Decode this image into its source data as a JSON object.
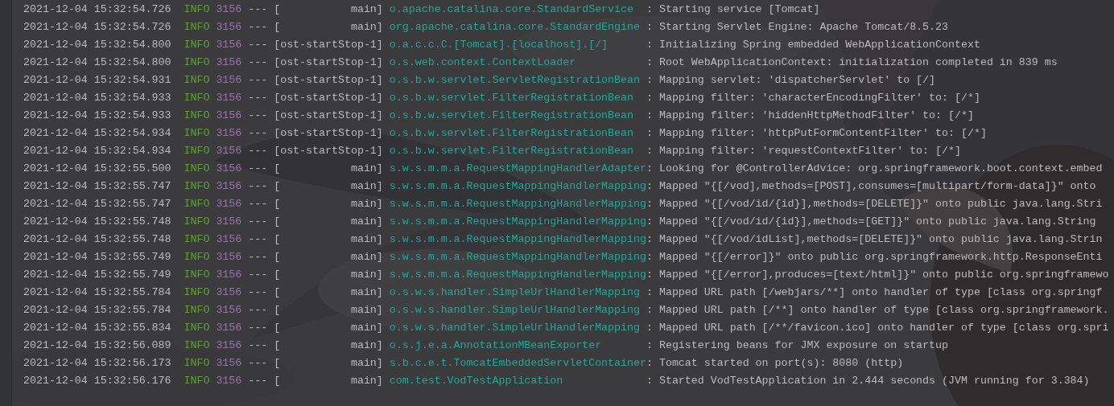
{
  "console": {
    "rows": [
      {
        "timestamp": "2021-12-04 15:32:54.726",
        "level": "INFO",
        "pid": "3156",
        "separator": "---",
        "thread": "[           main]",
        "logger": "o.apache.catalina.core.StandardService",
        "message": ": Starting service [Tomcat]"
      },
      {
        "timestamp": "2021-12-04 15:32:54.726",
        "level": "INFO",
        "pid": "3156",
        "separator": "---",
        "thread": "[           main]",
        "logger": "org.apache.catalina.core.StandardEngine",
        "message": ": Starting Servlet Engine: Apache Tomcat/8.5.23"
      },
      {
        "timestamp": "2021-12-04 15:32:54.800",
        "level": "INFO",
        "pid": "3156",
        "separator": "---",
        "thread": "[ost-startStop-1]",
        "logger": "o.a.c.c.C.[Tomcat].[localhost].[/]",
        "message": ": Initializing Spring embedded WebApplicationContext"
      },
      {
        "timestamp": "2021-12-04 15:32:54.800",
        "level": "INFO",
        "pid": "3156",
        "separator": "---",
        "thread": "[ost-startStop-1]",
        "logger": "o.s.web.context.ContextLoader",
        "message": ": Root WebApplicationContext: initialization completed in 839 ms"
      },
      {
        "timestamp": "2021-12-04 15:32:54.931",
        "level": "INFO",
        "pid": "3156",
        "separator": "---",
        "thread": "[ost-startStop-1]",
        "logger": "o.s.b.w.servlet.ServletRegistrationBean",
        "message": ": Mapping servlet: 'dispatcherServlet' to [/]"
      },
      {
        "timestamp": "2021-12-04 15:32:54.933",
        "level": "INFO",
        "pid": "3156",
        "separator": "---",
        "thread": "[ost-startStop-1]",
        "logger": "o.s.b.w.servlet.FilterRegistrationBean",
        "message": ": Mapping filter: 'characterEncodingFilter' to: [/*]"
      },
      {
        "timestamp": "2021-12-04 15:32:54.933",
        "level": "INFO",
        "pid": "3156",
        "separator": "---",
        "thread": "[ost-startStop-1]",
        "logger": "o.s.b.w.servlet.FilterRegistrationBean",
        "message": ": Mapping filter: 'hiddenHttpMethodFilter' to: [/*]"
      },
      {
        "timestamp": "2021-12-04 15:32:54.934",
        "level": "INFO",
        "pid": "3156",
        "separator": "---",
        "thread": "[ost-startStop-1]",
        "logger": "o.s.b.w.servlet.FilterRegistrationBean",
        "message": ": Mapping filter: 'httpPutFormContentFilter' to: [/*]"
      },
      {
        "timestamp": "2021-12-04 15:32:54.934",
        "level": "INFO",
        "pid": "3156",
        "separator": "---",
        "thread": "[ost-startStop-1]",
        "logger": "o.s.b.w.servlet.FilterRegistrationBean",
        "message": ": Mapping filter: 'requestContextFilter' to: [/*]"
      },
      {
        "timestamp": "2021-12-04 15:32:55.500",
        "level": "INFO",
        "pid": "3156",
        "separator": "---",
        "thread": "[           main]",
        "logger": "s.w.s.m.m.a.RequestMappingHandlerAdapter",
        "message": ": Looking for @ControllerAdvice: org.springframework.boot.context.embed"
      },
      {
        "timestamp": "2021-12-04 15:32:55.747",
        "level": "INFO",
        "pid": "3156",
        "separator": "---",
        "thread": "[           main]",
        "logger": "s.w.s.m.m.a.RequestMappingHandlerMapping",
        "message": ": Mapped \"{[/vod],methods=[POST],consumes=[multipart/form-data]}\" onto"
      },
      {
        "timestamp": "2021-12-04 15:32:55.747",
        "level": "INFO",
        "pid": "3156",
        "separator": "---",
        "thread": "[           main]",
        "logger": "s.w.s.m.m.a.RequestMappingHandlerMapping",
        "message": ": Mapped \"{[/vod/id/{id}],methods=[DELETE]}\" onto public java.lang.Stri"
      },
      {
        "timestamp": "2021-12-04 15:32:55.748",
        "level": "INFO",
        "pid": "3156",
        "separator": "---",
        "thread": "[           main]",
        "logger": "s.w.s.m.m.a.RequestMappingHandlerMapping",
        "message": ": Mapped \"{[/vod/id/{id}],methods=[GET]}\" onto public java.lang.String"
      },
      {
        "timestamp": "2021-12-04 15:32:55.748",
        "level": "INFO",
        "pid": "3156",
        "separator": "---",
        "thread": "[           main]",
        "logger": "s.w.s.m.m.a.RequestMappingHandlerMapping",
        "message": ": Mapped \"{[/vod/idList],methods=[DELETE]}\" onto public java.lang.Strin"
      },
      {
        "timestamp": "2021-12-04 15:32:55.749",
        "level": "INFO",
        "pid": "3156",
        "separator": "---",
        "thread": "[           main]",
        "logger": "s.w.s.m.m.a.RequestMappingHandlerMapping",
        "message": ": Mapped \"{[/error]}\" onto public org.springframework.http.ResponseEnti"
      },
      {
        "timestamp": "2021-12-04 15:32:55.749",
        "level": "INFO",
        "pid": "3156",
        "separator": "---",
        "thread": "[           main]",
        "logger": "s.w.s.m.m.a.RequestMappingHandlerMapping",
        "message": ": Mapped \"{[/error],produces=[text/html]}\" onto public org.springframewo"
      },
      {
        "timestamp": "2021-12-04 15:32:55.784",
        "level": "INFO",
        "pid": "3156",
        "separator": "---",
        "thread": "[           main]",
        "logger": "o.s.w.s.handler.SimpleUrlHandlerMapping",
        "message": ": Mapped URL path [/webjars/**] onto handler of type [class org.springf"
      },
      {
        "timestamp": "2021-12-04 15:32:55.784",
        "level": "INFO",
        "pid": "3156",
        "separator": "---",
        "thread": "[           main]",
        "logger": "o.s.w.s.handler.SimpleUrlHandlerMapping",
        "message": ": Mapped URL path [/**] onto handler of type [class org.springframework."
      },
      {
        "timestamp": "2021-12-04 15:32:55.834",
        "level": "INFO",
        "pid": "3156",
        "separator": "---",
        "thread": "[           main]",
        "logger": "o.s.w.s.handler.SimpleUrlHandlerMapping",
        "message": ": Mapped URL path [/**/favicon.ico] onto handler of type [class org.spri"
      },
      {
        "timestamp": "2021-12-04 15:32:56.089",
        "level": "INFO",
        "pid": "3156",
        "separator": "---",
        "thread": "[           main]",
        "logger": "o.s.j.e.a.AnnotationMBeanExporter",
        "message": ": Registering beans for JMX exposure on startup"
      },
      {
        "timestamp": "2021-12-04 15:32:56.173",
        "level": "INFO",
        "pid": "3156",
        "separator": "---",
        "thread": "[           main]",
        "logger": "s.b.c.e.t.TomcatEmbeddedServletContainer",
        "message": ": Tomcat started on port(s): 8080 (http)"
      },
      {
        "timestamp": "2021-12-04 15:32:56.176",
        "level": "INFO",
        "pid": "3156",
        "separator": "---",
        "thread": "[           main]",
        "logger": "com.test.VodTestApplication",
        "message": ": Started VodTestApplication in 2.444 seconds (JVM running for 3.384)"
      }
    ]
  }
}
